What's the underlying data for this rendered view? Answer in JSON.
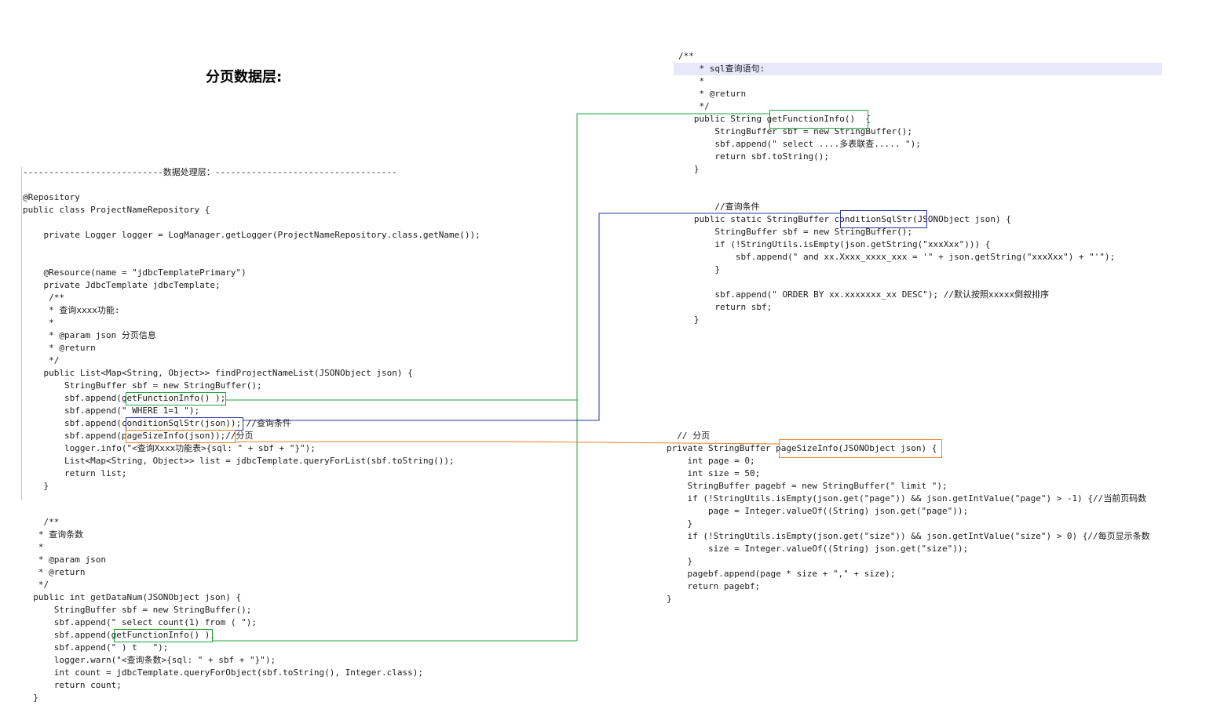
{
  "title": "分页数据层:",
  "colors": {
    "green": "#22a03a",
    "navy": "#26359a",
    "orange": "#e8822a",
    "highlight": "#e8e8fb"
  },
  "left_block": {
    "lines": [
      "---------------------------数据处理层：-----------------------------------",
      "",
      "@Repository",
      "public class ProjectNameRepository {",
      "",
      "    private Logger logger = LogManager.getLogger(ProjectNameRepository.class.getName());",
      "",
      "",
      "    @Resource(name = \"jdbcTemplatePrimary\")",
      "    private JdbcTemplate jdbcTemplate;",
      "     /**",
      "     * 查询xxxx功能:",
      "     *",
      "     * @param json 分页信息",
      "     * @return",
      "     */",
      "    public List<Map<String, Object>> findProjectNameList(JSONObject json) {",
      "        StringBuffer sbf = new StringBuffer();",
      "        sbf.append(getFunctionInfo() );",
      "        sbf.append(\" WHERE 1=1 \");",
      "        sbf.append(conditionSqlStr(json)); //查询条件",
      "        sbf.append(pageSizeInfo(json));//分页",
      "        logger.info(\"<查询Xxxx功能表>{sql: \" + sbf + \"}\");",
      "        List<Map<String, Object>> list = jdbcTemplate.queryForList(sbf.toString());",
      "        return list;",
      "    }"
    ]
  },
  "count_block": {
    "lines": [
      "    /**",
      "   * 查询条数",
      "   *",
      "   * @param json",
      "   * @return",
      "   */",
      "  public int getDataNum(JSONObject json) {",
      "      StringBuffer sbf = new StringBuffer();",
      "      sbf.append(\" select count(1) from ( \");",
      "      sbf.append(getFunctionInfo() );",
      "      sbf.append(\" ) t   \");",
      "      logger.warn(\"<查询条数>{sql: \" + sbf + \"}\");",
      "      int count = jdbcTemplate.queryForObject(sbf.toString(), Integer.class);",
      "      return count;",
      "  }"
    ]
  },
  "func_block": {
    "lines": [
      "/**",
      "    * sql查询语句:",
      "    *",
      "    * @return",
      "    */",
      "   public String getFunctionInfo()  {",
      "       StringBuffer sbf = new StringBuffer();",
      "       sbf.append(\" select ....多表联查..... \");",
      "       return sbf.toString();",
      "   }"
    ]
  },
  "cond_block": {
    "lines": [
      "       //查询条件",
      "   public static StringBuffer conditionSqlStr(JSONObject json) {",
      "       StringBuffer sbf = new StringBuffer();",
      "       if (!StringUtils.isEmpty(json.getString(\"xxxXxx\"))) {",
      "           sbf.append(\" and xx.Xxxx_xxxx_xxx = '\" + json.getString(\"xxxXxx\") + \"'\");",
      "       }",
      "",
      "       sbf.append(\" ORDER BY xx.xxxxxxx_xx DESC\"); //默认按照xxxxx倒叙排序",
      "       return sbf;",
      "   }"
    ]
  },
  "page_block": {
    "lines": [
      "  // 分页",
      "private StringBuffer pageSizeInfo(JSONObject json) {",
      "    int page = 0;",
      "    int size = 50;",
      "    StringBuffer pagebf = new StringBuffer(\" limit \");",
      "    if (!StringUtils.isEmpty(json.get(\"page\")) && json.getIntValue(\"page\") > -1) {//当前页码数",
      "        page = Integer.valueOf((String) json.get(\"page\"));",
      "    }",
      "    if (!StringUtils.isEmpty(json.get(\"size\")) && json.getIntValue(\"size\") > 0) {//每页显示条数",
      "        size = Integer.valueOf((String) json.get(\"size\"));",
      "    }",
      "    pagebf.append(page * size + \",\" + size);",
      "    return pagebf;",
      "}"
    ]
  }
}
